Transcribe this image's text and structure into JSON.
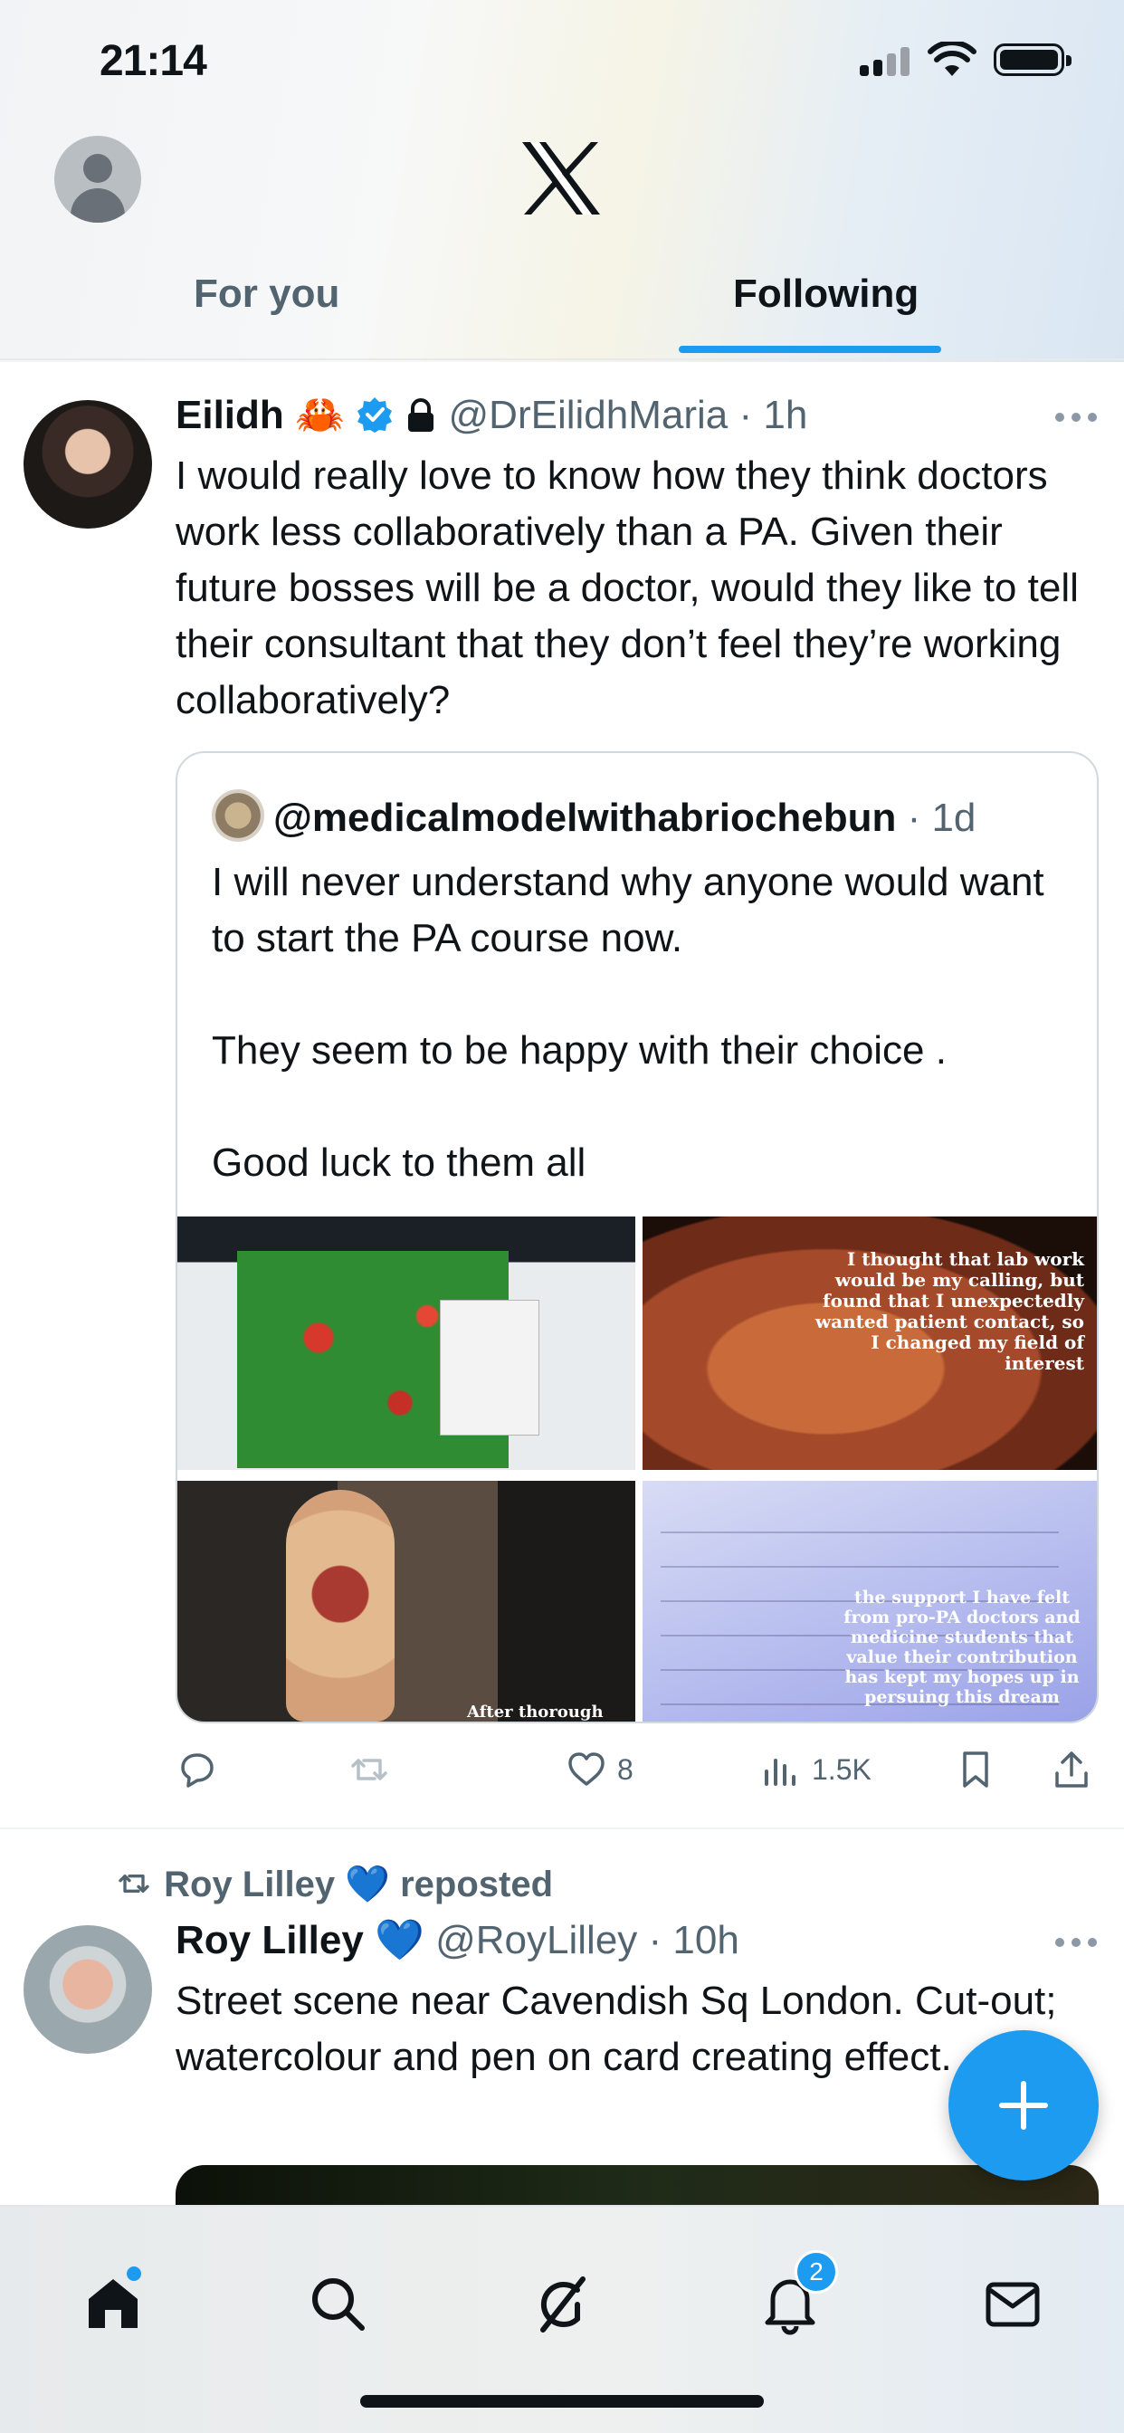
{
  "status_bar": {
    "time": "21:14"
  },
  "header": {
    "tabs": [
      {
        "label": "For you"
      },
      {
        "label": "Following"
      }
    ],
    "active_tab": "Following"
  },
  "posts": [
    {
      "name": "Eilidh",
      "name_emoji": "🦀",
      "verified": true,
      "protected": true,
      "handle": "@DrEilidhMaria",
      "time": "1h",
      "text": "I would really love to know how they think doctors work less collaboratively than a PA. Given their future bosses will be a doctor, would they like to tell their consultant that they don’t feel they’re working collaboratively?",
      "quote": {
        "handle": "@medicalmodelwithabriochebun",
        "time": "1d",
        "text": "I will never understand why anyone would want to start the PA course now.\n\nThey seem to be happy with their choice .\n\nGood luck to them all",
        "images": [
          {
            "caption": ""
          },
          {
            "caption": "I thought that lab work would be my calling, but found that I unexpectedly wanted patient contact, so I changed my field of interest"
          },
          {
            "caption": "After thorough"
          },
          {
            "caption": "the support I have felt from pro-PA doctors and medicine students that value their contribution has kept my hopes up in persuing this dream"
          }
        ]
      },
      "actions": {
        "reply": "",
        "repost": "",
        "likes": "8",
        "views": "1.5K"
      }
    },
    {
      "repost_label": "Roy Lilley 💙 reposted",
      "name": "Roy Lilley",
      "name_emoji": "💙",
      "handle": "@RoyLilley",
      "time": "10h",
      "text": "Street scene near Cavendish Sq London. Cut-out; watercolour and pen on card creating effect."
    }
  ],
  "bottom_nav": {
    "notifications_badge": "2"
  },
  "colors": {
    "accent": "#1d9bf0",
    "text": "#0f1419",
    "muted": "#536471"
  }
}
